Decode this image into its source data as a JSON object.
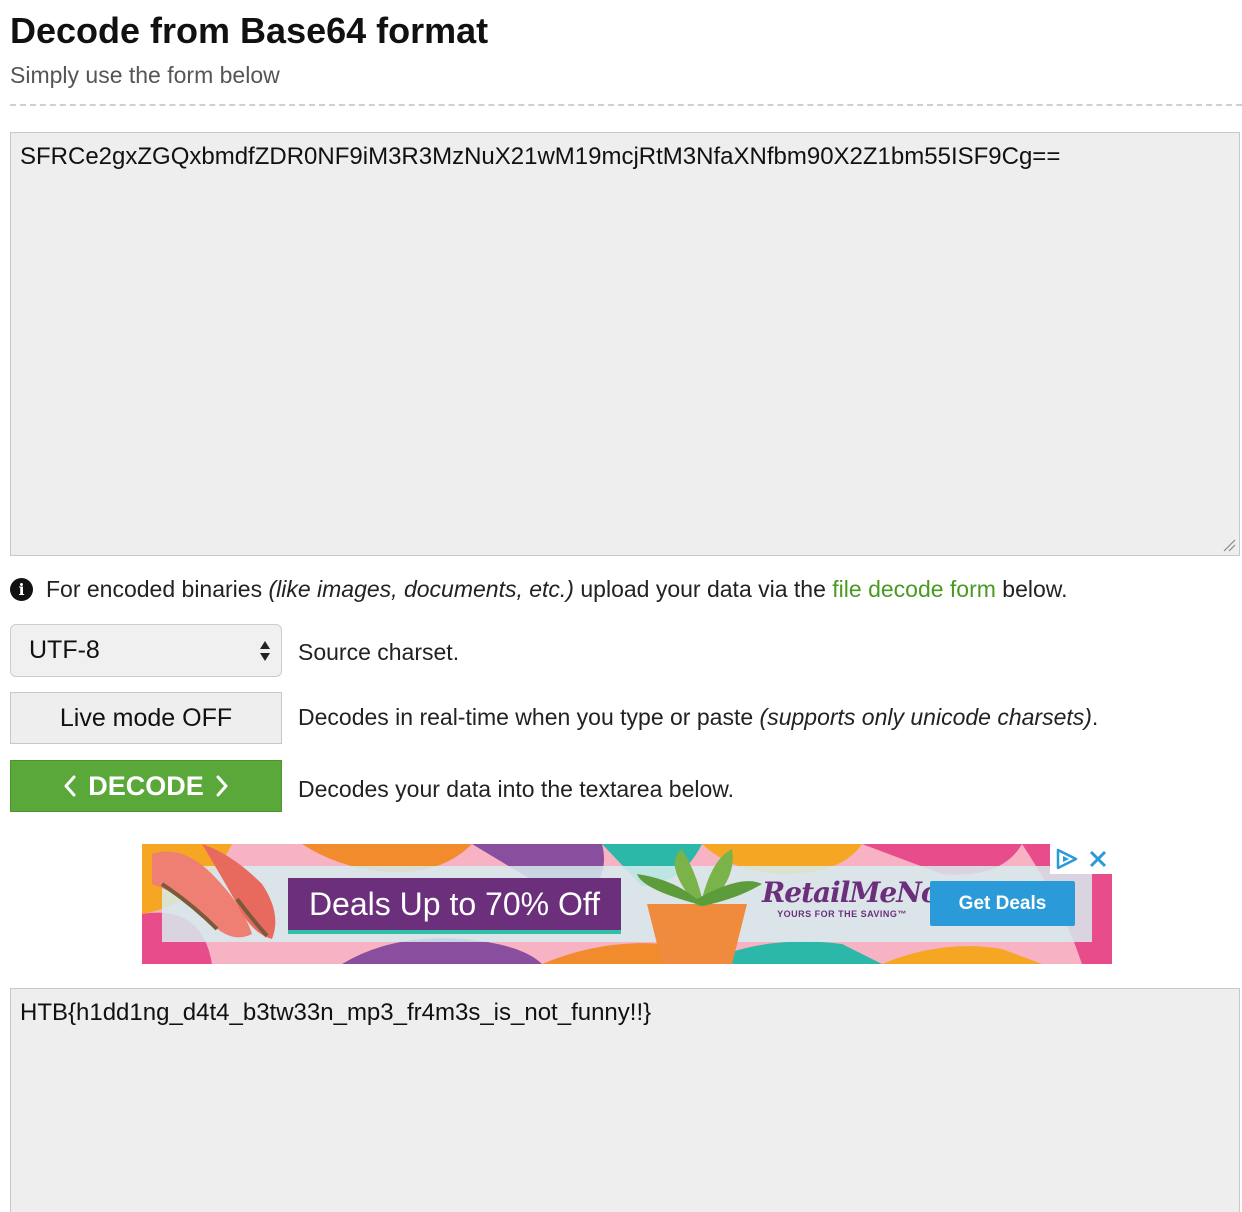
{
  "header": {
    "title": "Decode from Base64 format",
    "subtitle": "Simply use the form below"
  },
  "input": {
    "value": "SFRCe2gxZGQxbmdfZDR0NF9iM3R3MzNuX21wM19mcjRtM3NfaXNfbm90X2Z1bm55ISF9Cg=="
  },
  "info": {
    "icon": "info-icon",
    "text_before": "For encoded binaries ",
    "text_italic": "(like images, documents, etc.)",
    "text_middle": " upload your data via the ",
    "link_label": "file decode form",
    "text_after": " below.",
    "link_color": "#4a9a22"
  },
  "charset": {
    "selected": "UTF-8",
    "label": "Source charset."
  },
  "live_mode": {
    "button_label": "Live mode OFF",
    "description": "Decodes in real-time when you type or paste ",
    "description_italic": "(supports only unicode charsets)",
    "description_end": "."
  },
  "decode": {
    "button_label": "DECODE",
    "description": "Decodes your data into the textarea below.",
    "color": "#5aa83a"
  },
  "ad": {
    "headline": "Deals Up to 70% Off",
    "brand": "RetailMeNot",
    "tagline": "YOURS FOR THE SAVING™",
    "cta": "Get Deals"
  },
  "output": {
    "value": "HTB{h1dd1ng_d4t4_b3tw33n_mp3_fr4m3s_is_not_funny!!}"
  }
}
